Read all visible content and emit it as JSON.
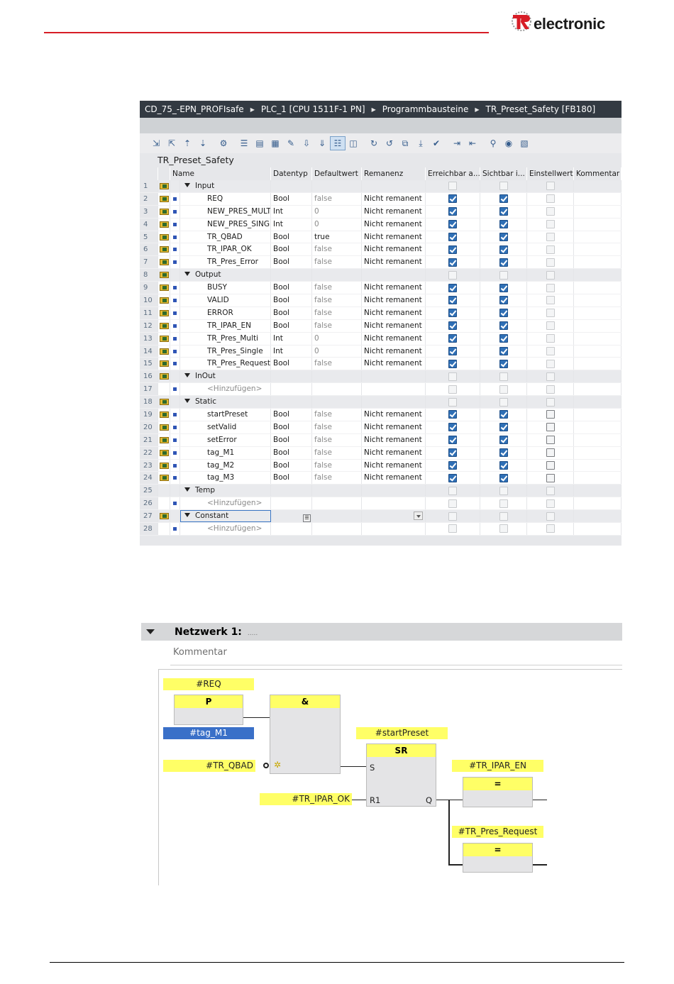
{
  "brand": {
    "logo_text": "electronic",
    "logo_mark": "TR"
  },
  "breadcrumb": [
    "CD_75_-EPN_PROFIsafe",
    "PLC_1 [CPU 1511F-1 PN]",
    "Programmbausteine",
    "TR_Preset_Safety [FB180]"
  ],
  "block_title": "TR_Preset_Safety",
  "columns": {
    "name": "Name",
    "datatype": "Datentyp",
    "default": "Defaultwert",
    "retain": "Remanenz",
    "accessible": "Erreichbar a...",
    "visible": "Sichtbar i...",
    "setpoint": "Einstellwert",
    "comment": "Kommentar"
  },
  "rows": [
    {
      "n": "1",
      "name": "Input",
      "type": "section",
      "icon": true,
      "er": false,
      "si": false,
      "ei": false
    },
    {
      "n": "2",
      "name": "REQ",
      "dt": "Bool",
      "dv": "false",
      "rm": "Nicht remanent",
      "icon": true,
      "er": true,
      "si": true,
      "ei": false
    },
    {
      "n": "3",
      "name": "NEW_PRES_MULTI",
      "dt": "Int",
      "dv": "0",
      "rm": "Nicht remanent",
      "icon": true,
      "er": true,
      "si": true,
      "ei": false
    },
    {
      "n": "4",
      "name": "NEW_PRES_SINGLE",
      "dt": "Int",
      "dv": "0",
      "rm": "Nicht remanent",
      "icon": true,
      "er": true,
      "si": true,
      "ei": false
    },
    {
      "n": "5",
      "name": "TR_QBAD",
      "dt": "Bool",
      "dv": "true",
      "rm": "Nicht remanent",
      "icon": true,
      "er": true,
      "si": true,
      "ei": false
    },
    {
      "n": "6",
      "name": "TR_IPAR_OK",
      "dt": "Bool",
      "dv": "false",
      "rm": "Nicht remanent",
      "icon": true,
      "er": true,
      "si": true,
      "ei": false
    },
    {
      "n": "7",
      "name": "TR_Pres_Error",
      "dt": "Bool",
      "dv": "false",
      "rm": "Nicht remanent",
      "icon": true,
      "er": true,
      "si": true,
      "ei": false
    },
    {
      "n": "8",
      "name": "Output",
      "type": "section",
      "icon": true,
      "er": false,
      "si": false,
      "ei": false
    },
    {
      "n": "9",
      "name": "BUSY",
      "dt": "Bool",
      "dv": "false",
      "rm": "Nicht remanent",
      "icon": true,
      "er": true,
      "si": true,
      "ei": false
    },
    {
      "n": "10",
      "name": "VALID",
      "dt": "Bool",
      "dv": "false",
      "rm": "Nicht remanent",
      "icon": true,
      "er": true,
      "si": true,
      "ei": false
    },
    {
      "n": "11",
      "name": "ERROR",
      "dt": "Bool",
      "dv": "false",
      "rm": "Nicht remanent",
      "icon": true,
      "er": true,
      "si": true,
      "ei": false
    },
    {
      "n": "12",
      "name": "TR_IPAR_EN",
      "dt": "Bool",
      "dv": "false",
      "rm": "Nicht remanent",
      "icon": true,
      "er": true,
      "si": true,
      "ei": false
    },
    {
      "n": "13",
      "name": "TR_Pres_Multi",
      "dt": "Int",
      "dv": "0",
      "rm": "Nicht remanent",
      "icon": true,
      "er": true,
      "si": true,
      "ei": false
    },
    {
      "n": "14",
      "name": "TR_Pres_Single",
      "dt": "Int",
      "dv": "0",
      "rm": "Nicht remanent",
      "icon": true,
      "er": true,
      "si": true,
      "ei": false
    },
    {
      "n": "15",
      "name": "TR_Pres_Request",
      "dt": "Bool",
      "dv": "false",
      "rm": "Nicht remanent",
      "icon": true,
      "er": true,
      "si": true,
      "ei": false
    },
    {
      "n": "16",
      "name": "InOut",
      "type": "section",
      "icon": true,
      "er": false,
      "si": false,
      "ei": false
    },
    {
      "n": "17",
      "name": "<Hinzufügen>",
      "type": "hint",
      "icon": false,
      "er": false,
      "si": false,
      "ei": false
    },
    {
      "n": "18",
      "name": "Static",
      "type": "section",
      "icon": true,
      "er": false,
      "si": false,
      "ei": false
    },
    {
      "n": "19",
      "name": "startPreset",
      "dt": "Bool",
      "dv": "false",
      "rm": "Nicht remanent",
      "icon": true,
      "er": true,
      "si": true,
      "ei": "dark"
    },
    {
      "n": "20",
      "name": "setValid",
      "dt": "Bool",
      "dv": "false",
      "rm": "Nicht remanent",
      "icon": true,
      "er": true,
      "si": true,
      "ei": "dark"
    },
    {
      "n": "21",
      "name": "setError",
      "dt": "Bool",
      "dv": "false",
      "rm": "Nicht remanent",
      "icon": true,
      "er": true,
      "si": true,
      "ei": "dark"
    },
    {
      "n": "22",
      "name": "tag_M1",
      "dt": "Bool",
      "dv": "false",
      "rm": "Nicht remanent",
      "icon": true,
      "er": true,
      "si": true,
      "ei": "dark"
    },
    {
      "n": "23",
      "name": "tag_M2",
      "dt": "Bool",
      "dv": "false",
      "rm": "Nicht remanent",
      "icon": true,
      "er": true,
      "si": true,
      "ei": "dark"
    },
    {
      "n": "24",
      "name": "tag_M3",
      "dt": "Bool",
      "dv": "false",
      "rm": "Nicht remanent",
      "icon": true,
      "er": true,
      "si": true,
      "ei": "dark"
    },
    {
      "n": "25",
      "name": "Temp",
      "type": "section",
      "icon": false,
      "er": false,
      "si": false,
      "ei": false
    },
    {
      "n": "26",
      "name": "<Hinzufügen>",
      "type": "hint",
      "icon": false,
      "er": false,
      "si": false,
      "ei": false
    },
    {
      "n": "27",
      "name": "Constant",
      "type": "section",
      "icon": true,
      "selected": true,
      "er": false,
      "si": false,
      "ei": false
    },
    {
      "n": "28",
      "name": "<Hinzufügen>",
      "type": "hint",
      "icon": false,
      "er": false,
      "si": false,
      "ei": false
    }
  ],
  "network": {
    "title": "Netzwerk 1:",
    "title_dots": ".....",
    "comment_placeholder": "Kommentar",
    "labels": {
      "req": "#REQ",
      "tag_m1": "#tag_M1",
      "tr_qbad": "#TR_QBAD",
      "tr_ipar_ok": "#TR_IPAR_OK",
      "start_preset": "#startPreset",
      "tr_ipar_en": "#TR_IPAR_EN",
      "tr_pres_request": "#TR_Pres_Request"
    },
    "boxes": {
      "p": "P",
      "and": "&",
      "sr": "SR",
      "assign1": "=",
      "assign2": "="
    },
    "pins": {
      "s": "S",
      "r1": "R1",
      "q": "Q"
    }
  },
  "colors": {
    "accent_red": "#d71d26",
    "highlight": "#ffff66",
    "selection": "#3a70c8",
    "breadcrumb_bg": "#333a42"
  }
}
